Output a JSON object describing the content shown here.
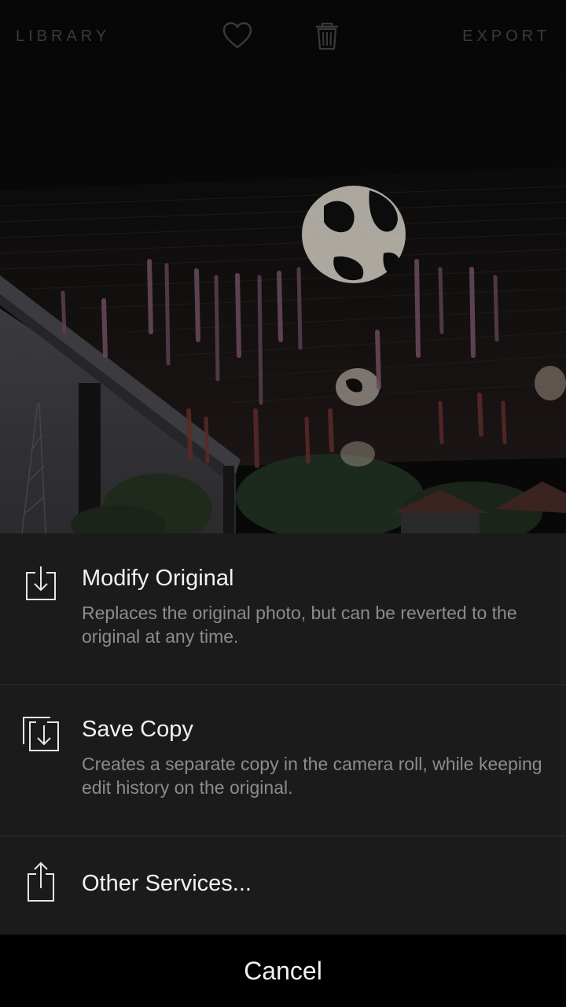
{
  "toolbar": {
    "library_label": "LIBRARY",
    "export_label": "EXPORT",
    "heart_icon": "heart-icon",
    "trash_icon": "trash-icon"
  },
  "photo": {
    "description_icon": "photo-preview"
  },
  "sheet": {
    "options": [
      {
        "icon": "save-to-device-icon",
        "title": "Modify Original",
        "description": "Replaces the original photo, but can be reverted to the original at any time."
      },
      {
        "icon": "save-copy-icon",
        "title": "Save Copy",
        "description": "Creates a separate copy in the camera roll, while keeping edit history on the original."
      },
      {
        "icon": "share-icon",
        "title": "Other Services..."
      }
    ],
    "cancel_label": "Cancel"
  },
  "colors": {
    "sheet_background": "#1b1b1b",
    "toolbar_text": "#3a3a3a",
    "title_text": "#f2f2f2",
    "description_text": "#8c8c8c"
  }
}
